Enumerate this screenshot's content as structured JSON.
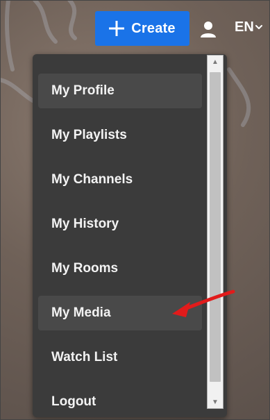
{
  "header": {
    "create_button": {
      "label": "Create"
    },
    "user_icon": "user-icon",
    "language": {
      "label": "EN"
    }
  },
  "dropdown": {
    "items": [
      {
        "label": "My Profile"
      },
      {
        "label": "My Playlists"
      },
      {
        "label": "My Channels"
      },
      {
        "label": "My History"
      },
      {
        "label": "My Rooms"
      },
      {
        "label": "My Media"
      },
      {
        "label": "Watch List"
      },
      {
        "label": "Logout"
      }
    ]
  },
  "colors": {
    "create_button": "#1a73e8",
    "dropdown_bg": "#3b3b3b",
    "highlight_bg": "#494949",
    "annotation_arrow": "#e11b1b"
  },
  "icons": {
    "plus": "plus-icon",
    "user": "user-icon",
    "chevron": "chevron-down-icon",
    "scroll_up": "scroll-up-arrow",
    "scroll_down": "scroll-down-arrow"
  }
}
